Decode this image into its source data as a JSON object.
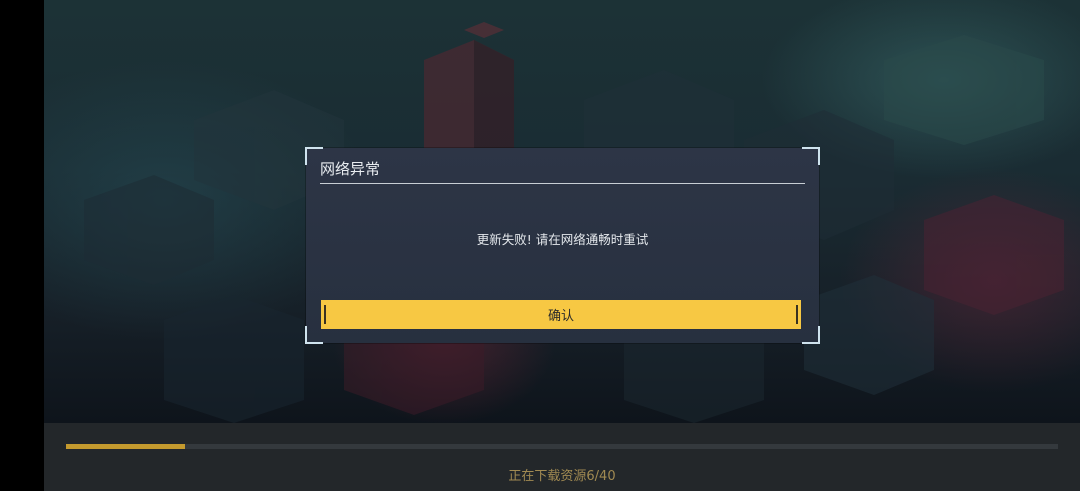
{
  "dialog": {
    "title": "网络异常",
    "message": "更新失败! 请在网络通畅时重试",
    "confirm_label": "确认"
  },
  "download": {
    "status_text": "正在下载资源6/40",
    "progress_fraction": 0.12
  },
  "colors": {
    "accent": "#f7c843",
    "progress_fill": "#c49a2e",
    "dialog_bg": "#2b3343"
  }
}
